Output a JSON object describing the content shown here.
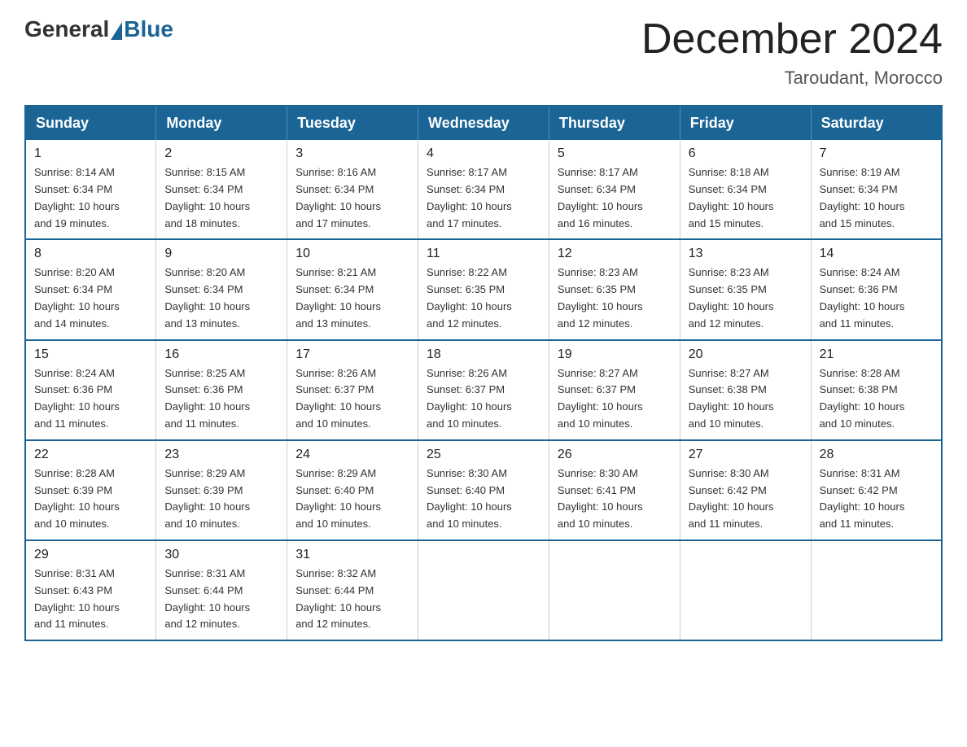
{
  "header": {
    "logo_general": "General",
    "logo_blue": "Blue",
    "month_title": "December 2024",
    "location": "Taroudant, Morocco"
  },
  "weekdays": [
    "Sunday",
    "Monday",
    "Tuesday",
    "Wednesday",
    "Thursday",
    "Friday",
    "Saturday"
  ],
  "weeks": [
    [
      {
        "day": "1",
        "sunrise": "8:14 AM",
        "sunset": "6:34 PM",
        "daylight": "10 hours and 19 minutes."
      },
      {
        "day": "2",
        "sunrise": "8:15 AM",
        "sunset": "6:34 PM",
        "daylight": "10 hours and 18 minutes."
      },
      {
        "day": "3",
        "sunrise": "8:16 AM",
        "sunset": "6:34 PM",
        "daylight": "10 hours and 17 minutes."
      },
      {
        "day": "4",
        "sunrise": "8:17 AM",
        "sunset": "6:34 PM",
        "daylight": "10 hours and 17 minutes."
      },
      {
        "day": "5",
        "sunrise": "8:17 AM",
        "sunset": "6:34 PM",
        "daylight": "10 hours and 16 minutes."
      },
      {
        "day": "6",
        "sunrise": "8:18 AM",
        "sunset": "6:34 PM",
        "daylight": "10 hours and 15 minutes."
      },
      {
        "day": "7",
        "sunrise": "8:19 AM",
        "sunset": "6:34 PM",
        "daylight": "10 hours and 15 minutes."
      }
    ],
    [
      {
        "day": "8",
        "sunrise": "8:20 AM",
        "sunset": "6:34 PM",
        "daylight": "10 hours and 14 minutes."
      },
      {
        "day": "9",
        "sunrise": "8:20 AM",
        "sunset": "6:34 PM",
        "daylight": "10 hours and 13 minutes."
      },
      {
        "day": "10",
        "sunrise": "8:21 AM",
        "sunset": "6:34 PM",
        "daylight": "10 hours and 13 minutes."
      },
      {
        "day": "11",
        "sunrise": "8:22 AM",
        "sunset": "6:35 PM",
        "daylight": "10 hours and 12 minutes."
      },
      {
        "day": "12",
        "sunrise": "8:23 AM",
        "sunset": "6:35 PM",
        "daylight": "10 hours and 12 minutes."
      },
      {
        "day": "13",
        "sunrise": "8:23 AM",
        "sunset": "6:35 PM",
        "daylight": "10 hours and 12 minutes."
      },
      {
        "day": "14",
        "sunrise": "8:24 AM",
        "sunset": "6:36 PM",
        "daylight": "10 hours and 11 minutes."
      }
    ],
    [
      {
        "day": "15",
        "sunrise": "8:24 AM",
        "sunset": "6:36 PM",
        "daylight": "10 hours and 11 minutes."
      },
      {
        "day": "16",
        "sunrise": "8:25 AM",
        "sunset": "6:36 PM",
        "daylight": "10 hours and 11 minutes."
      },
      {
        "day": "17",
        "sunrise": "8:26 AM",
        "sunset": "6:37 PM",
        "daylight": "10 hours and 10 minutes."
      },
      {
        "day": "18",
        "sunrise": "8:26 AM",
        "sunset": "6:37 PM",
        "daylight": "10 hours and 10 minutes."
      },
      {
        "day": "19",
        "sunrise": "8:27 AM",
        "sunset": "6:37 PM",
        "daylight": "10 hours and 10 minutes."
      },
      {
        "day": "20",
        "sunrise": "8:27 AM",
        "sunset": "6:38 PM",
        "daylight": "10 hours and 10 minutes."
      },
      {
        "day": "21",
        "sunrise": "8:28 AM",
        "sunset": "6:38 PM",
        "daylight": "10 hours and 10 minutes."
      }
    ],
    [
      {
        "day": "22",
        "sunrise": "8:28 AM",
        "sunset": "6:39 PM",
        "daylight": "10 hours and 10 minutes."
      },
      {
        "day": "23",
        "sunrise": "8:29 AM",
        "sunset": "6:39 PM",
        "daylight": "10 hours and 10 minutes."
      },
      {
        "day": "24",
        "sunrise": "8:29 AM",
        "sunset": "6:40 PM",
        "daylight": "10 hours and 10 minutes."
      },
      {
        "day": "25",
        "sunrise": "8:30 AM",
        "sunset": "6:40 PM",
        "daylight": "10 hours and 10 minutes."
      },
      {
        "day": "26",
        "sunrise": "8:30 AM",
        "sunset": "6:41 PM",
        "daylight": "10 hours and 10 minutes."
      },
      {
        "day": "27",
        "sunrise": "8:30 AM",
        "sunset": "6:42 PM",
        "daylight": "10 hours and 11 minutes."
      },
      {
        "day": "28",
        "sunrise": "8:31 AM",
        "sunset": "6:42 PM",
        "daylight": "10 hours and 11 minutes."
      }
    ],
    [
      {
        "day": "29",
        "sunrise": "8:31 AM",
        "sunset": "6:43 PM",
        "daylight": "10 hours and 11 minutes."
      },
      {
        "day": "30",
        "sunrise": "8:31 AM",
        "sunset": "6:44 PM",
        "daylight": "10 hours and 12 minutes."
      },
      {
        "day": "31",
        "sunrise": "8:32 AM",
        "sunset": "6:44 PM",
        "daylight": "10 hours and 12 minutes."
      },
      null,
      null,
      null,
      null
    ]
  ]
}
